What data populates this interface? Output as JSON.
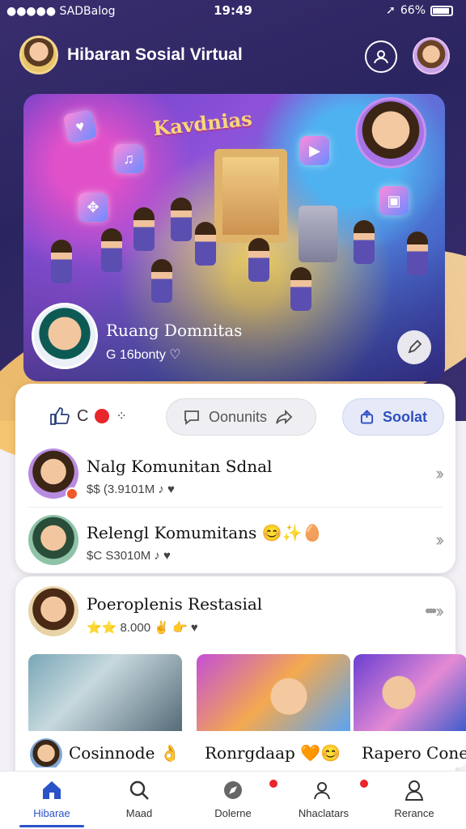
{
  "status_bar": {
    "carrier": "●●●●● SADBalog",
    "time": "19:49",
    "battery": "66%"
  },
  "header": {
    "title": "Hibaran Sosial Virtual"
  },
  "hero": {
    "banner_text": "Kavdnias",
    "user_name": "Ruang Domnitas",
    "user_sub": "G 16bonty ♡"
  },
  "actions": {
    "like_label": "C",
    "like_dots": "⁘",
    "comment_label": "Oonunits",
    "share_label": "Soolat"
  },
  "list": [
    {
      "title": "Nalg Komunitan Sdnal",
      "meta": "$$ (3.9101M ♪ ♥"
    },
    {
      "title": "Relengl Komumitans 😊✨🥚",
      "meta": "$C S3010M ♪ ♥"
    }
  ],
  "feature": {
    "title": "Poeroplenis Restasial",
    "meta": "⭐⭐ 8.000 ✌ 👉 ♥"
  },
  "tiles": [
    {
      "caption": "Cosinnode 👌"
    },
    {
      "caption": "Ronrgdaap 🧡😊"
    },
    {
      "caption": "Rapero Cone"
    }
  ],
  "tabs": [
    {
      "label": "Hibarae"
    },
    {
      "label": "Maad"
    },
    {
      "label": "Dolerne"
    },
    {
      "label": "Nhaclatars"
    },
    {
      "label": "Rerance"
    }
  ],
  "colors": {
    "accent": "#2a52c9",
    "badge": "#e8262b",
    "header_bg": "#2a2560"
  }
}
